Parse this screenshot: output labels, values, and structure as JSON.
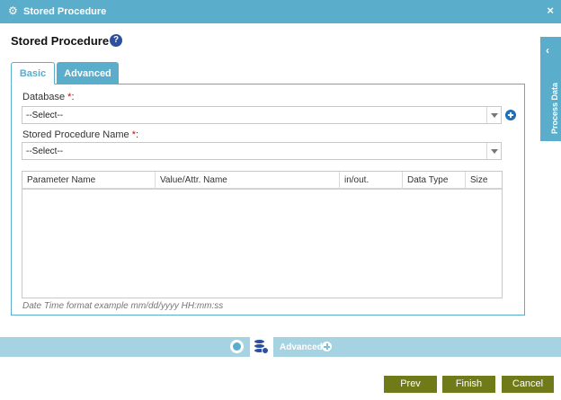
{
  "window": {
    "title": "Stored Procedure",
    "close_symbol": "×"
  },
  "page": {
    "heading": "Stored Procedure",
    "help_symbol": "?"
  },
  "tabs": [
    {
      "label": "Basic",
      "active": true
    },
    {
      "label": "Advanced",
      "active": false
    }
  ],
  "form": {
    "database": {
      "label": "Database",
      "required_mark": "*",
      "suffix": ":",
      "value": "--Select--"
    },
    "procedure": {
      "label": "Stored Procedure Name",
      "required_mark": "*",
      "suffix": ":",
      "value": "--Select--"
    }
  },
  "grid": {
    "columns": [
      "Parameter Name",
      "Value/Attr. Name",
      "in/out.",
      "Data Type",
      "Size"
    ],
    "rows": []
  },
  "hint": "Date Time format example mm/dd/yyyy HH:mm:ss",
  "side_panel": {
    "label": "Process Data",
    "chevron": "‹"
  },
  "bottom_bar": {
    "advanced_label": "Advanced"
  },
  "buttons": {
    "prev": "Prev",
    "finish": "Finish",
    "cancel": "Cancel"
  },
  "colors": {
    "accent": "#5aaecb",
    "button": "#717a19",
    "icon_blue": "#2d4f9f",
    "required": "#dd0000"
  }
}
